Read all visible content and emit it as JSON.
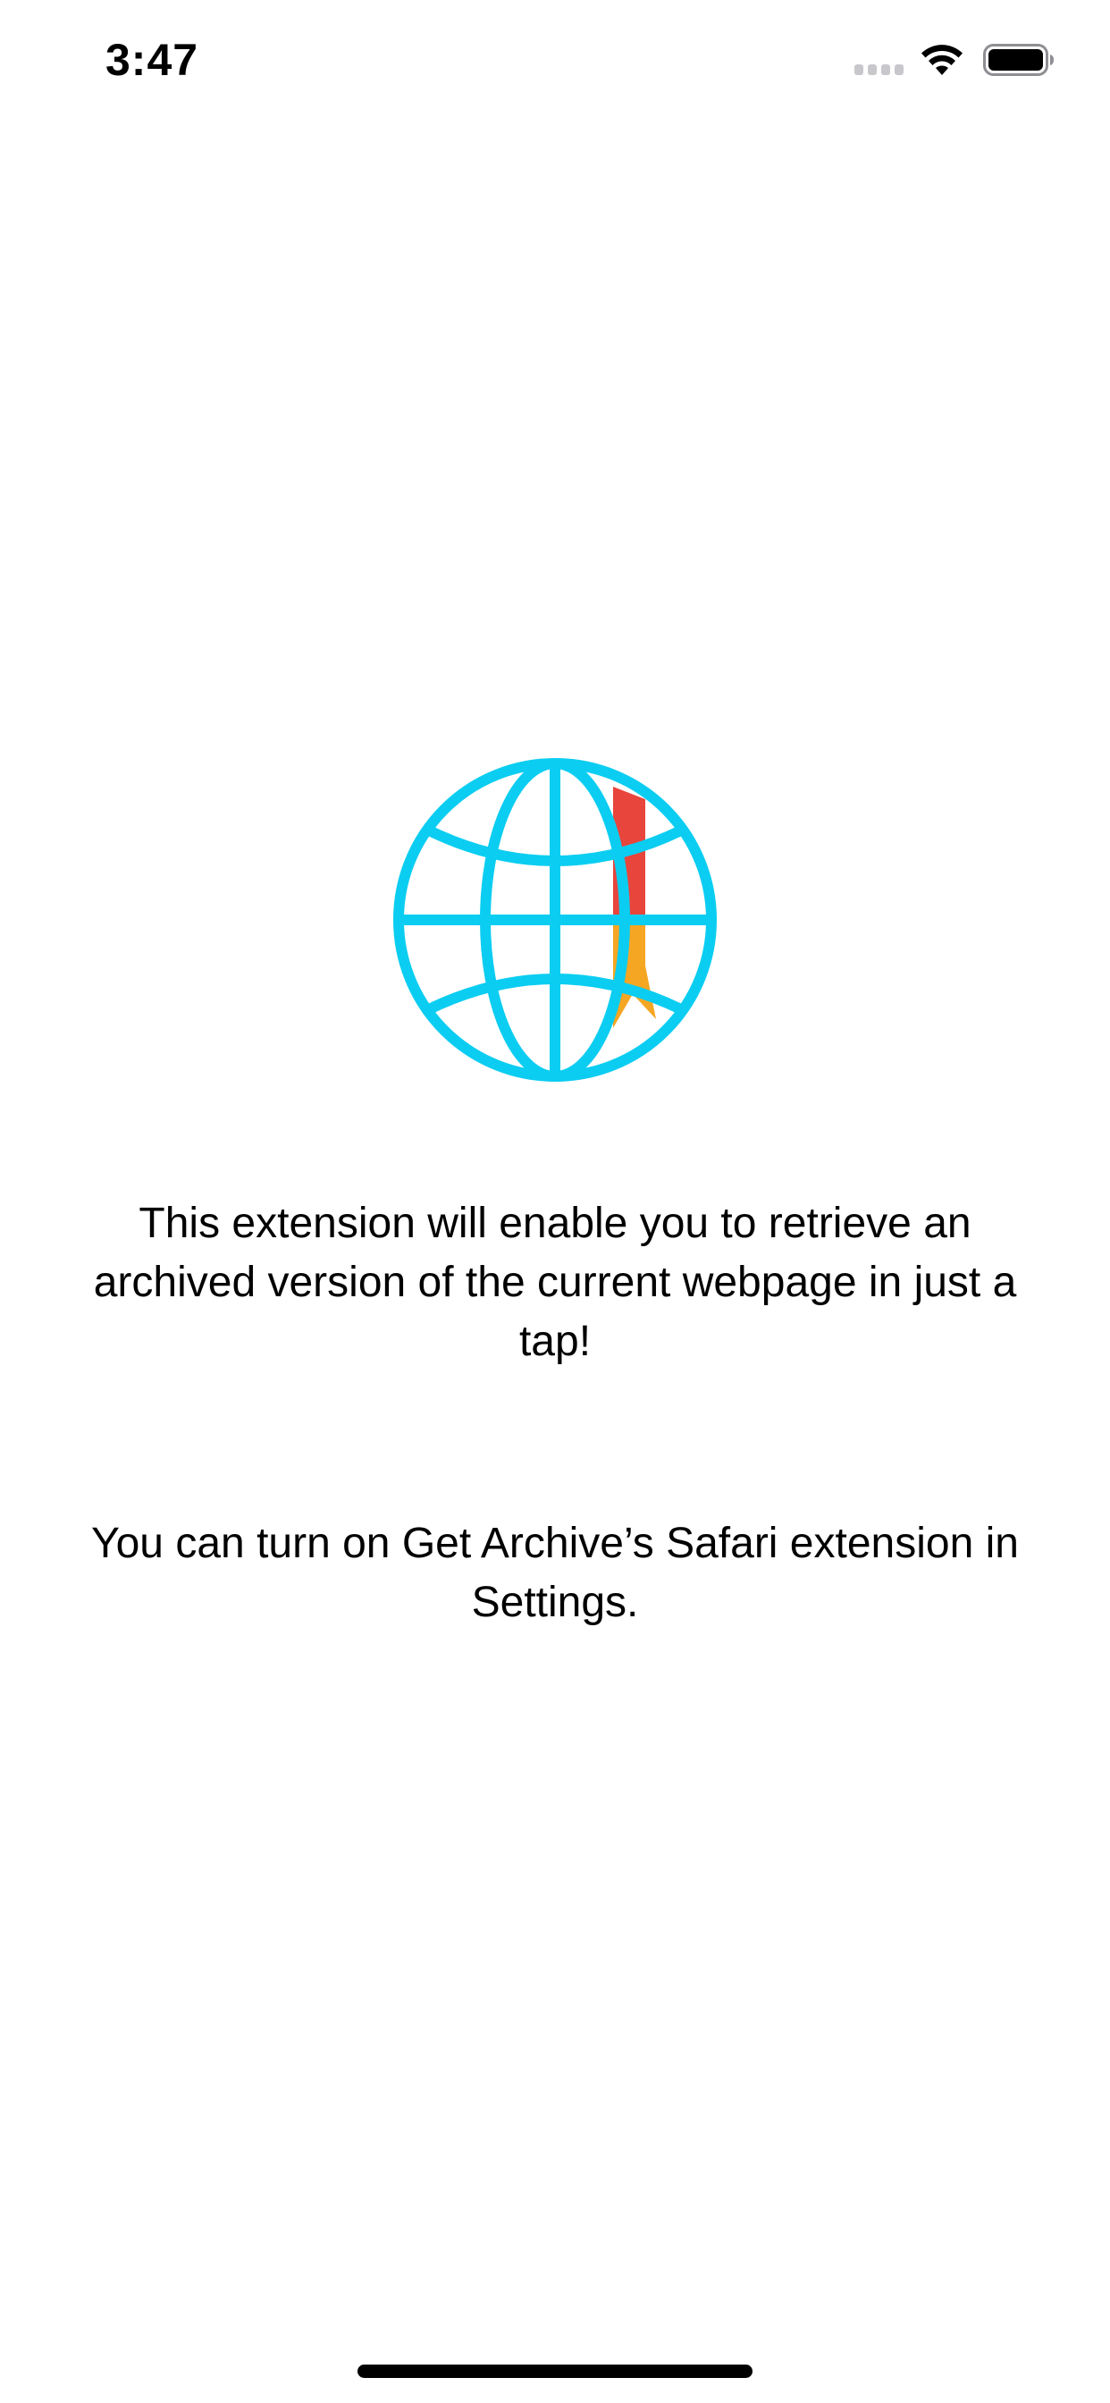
{
  "status_bar": {
    "time": "3:47"
  },
  "app_icon": {
    "icon": "globe-bookmark-icon",
    "globe_color": "#0BCDF1",
    "ribbon_top_color": "#E8453C",
    "ribbon_bottom_color": "#F5A623"
  },
  "content": {
    "description": "This extension will enable you to retrieve an archived version of the current webpage in just a tap!",
    "instructions": "You can turn on Get Archive’s Safari extension in Settings."
  }
}
